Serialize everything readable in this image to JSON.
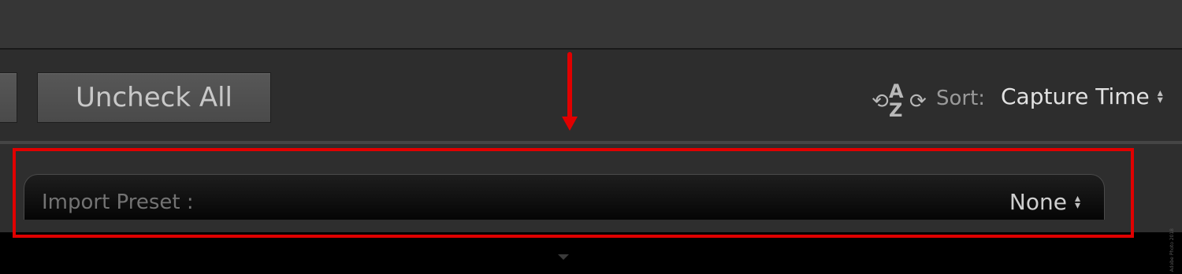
{
  "toolbar": {
    "uncheck_all_label": "Uncheck All",
    "sort_label": "Sort:",
    "sort_value": "Capture Time"
  },
  "import_preset": {
    "label": "Import Preset :",
    "value": "None"
  },
  "annotation": {
    "color": "#e00000"
  },
  "watermark": "Adobe Photo 2018",
  "icons": [
    "sort-az-icon",
    "updown-chevron-icon",
    "collapse-triangle-icon"
  ]
}
